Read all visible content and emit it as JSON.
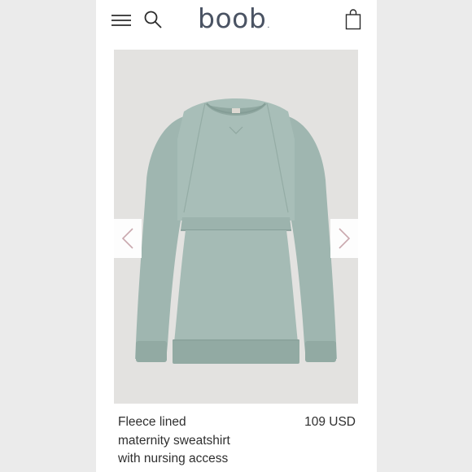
{
  "header": {
    "menu_icon": "hamburger-menu-icon",
    "search_icon": "search-icon",
    "logo_text": "boob",
    "logo_dot": ".",
    "cart_icon": "shopping-bag-icon"
  },
  "gallery": {
    "image_alt": "sage green sweatshirt",
    "prev_icon": "chevron-left-icon",
    "next_icon": "chevron-right-icon"
  },
  "product": {
    "title_lines": [
      "Fleece lined",
      "maternity sweatshirt",
      "with nursing access"
    ],
    "price": "109 USD"
  },
  "colors": {
    "logo": "#4a5363",
    "garment": "#a3bab4",
    "image_background": "#e3e2e0",
    "arrow": "#c9a8ae"
  }
}
